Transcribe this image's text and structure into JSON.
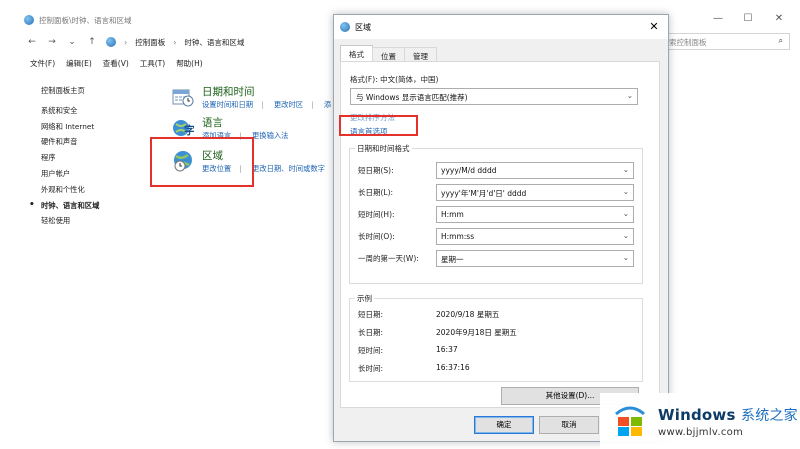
{
  "control_panel": {
    "title": "控制面板\\时钟、语言和区域",
    "window_buttons": [
      "—",
      "☐",
      "✕"
    ],
    "nav": {
      "back": "←",
      "forward": "→",
      "dropdown": "⌄",
      "up": "↑",
      "sep": "›",
      "crumbs": [
        "控制面板",
        "时钟、语言和区域"
      ]
    },
    "search_placeholder": "索控制面板",
    "search_icon": "⌕",
    "menu": [
      "文件(F)",
      "编辑(E)",
      "查看(V)",
      "工具(T)",
      "帮助(H)"
    ],
    "sidebar": {
      "home": "控制面板主页",
      "items": [
        "系统和安全",
        "网络和 Internet",
        "硬件和声音",
        "程序",
        "用户帐户",
        "外观和个性化",
        "时钟、语言和区域",
        "轻松使用"
      ]
    },
    "categories": [
      {
        "title": "日期和时间",
        "links": [
          "设置时间和日期",
          "更改时区",
          "添"
        ]
      },
      {
        "title": "语言",
        "links": [
          "添加语言",
          "更换输入法"
        ]
      },
      {
        "title": "区域",
        "links": [
          "更改位置",
          "更改日期、时间或数字"
        ]
      }
    ]
  },
  "dialog": {
    "title": "区域",
    "close": "✕",
    "tabs": [
      "格式",
      "位置",
      "管理"
    ],
    "format_label": "格式(F): 中文(简体，中国)",
    "format_value": "与 Windows 显示语言匹配(推荐)",
    "sort_link": "更改排序方法",
    "lang_pref_link": "语言首选项",
    "datetime_group": "日期和时间格式",
    "rows": [
      {
        "label": "短日期(S):",
        "value": "yyyy/M/d dddd"
      },
      {
        "label": "长日期(L):",
        "value": "yyyy'年'M'月'd'日' dddd"
      },
      {
        "label": "短时间(H):",
        "value": "H:mm"
      },
      {
        "label": "长时间(O):",
        "value": "H:mm:ss"
      },
      {
        "label": "一周的第一天(W):",
        "value": "星期一"
      }
    ],
    "example_group": "示例",
    "examples": [
      {
        "label": "短日期:",
        "value": "2020/9/18 星期五"
      },
      {
        "label": "长日期:",
        "value": "2020年9月18日 星期五"
      },
      {
        "label": "短时间:",
        "value": "16:37"
      },
      {
        "label": "长时间:",
        "value": "16:37:16"
      }
    ],
    "other_settings": "其他设置(D)...",
    "ok": "确定",
    "cancel": "取消",
    "chevron": "⌄"
  },
  "watermark": {
    "brand": "Windows",
    "brand_zh": "系统之家",
    "url": "www.bjjmlv.com"
  }
}
